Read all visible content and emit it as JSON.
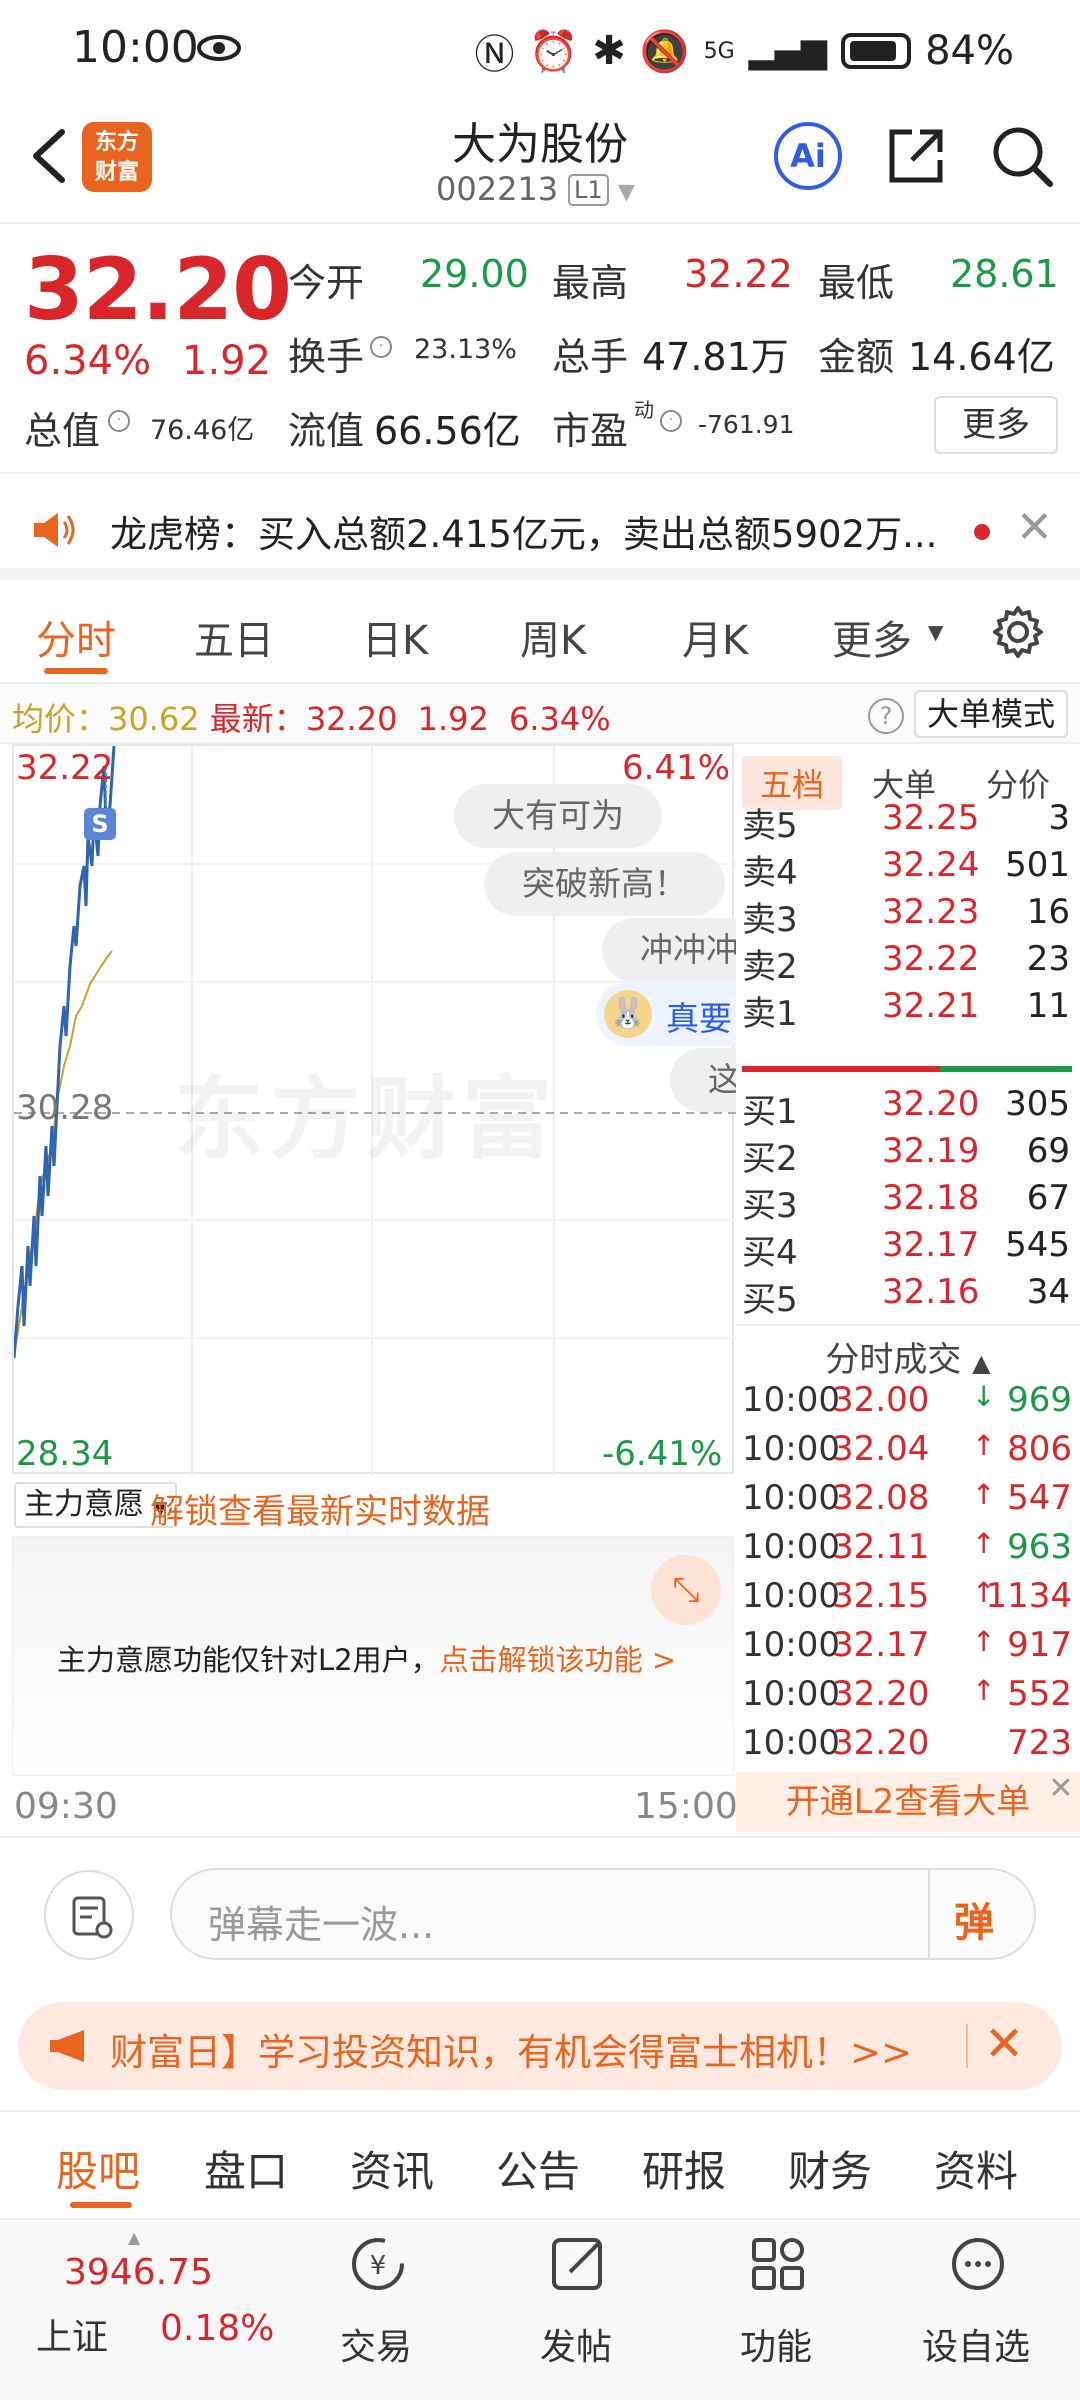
{
  "status": {
    "time": "10:00",
    "battery": "84%",
    "network": "5G"
  },
  "header": {
    "name": "大为股份",
    "code": "002213",
    "level": "L1",
    "ai_label": "Ai"
  },
  "quote": {
    "price": "32.20",
    "pct": "6.34%",
    "change": "1.92",
    "open_label": "今开",
    "open": "29.00",
    "high_label": "最高",
    "high": "32.22",
    "low_label": "最低",
    "low": "28.61",
    "turnover_label": "换手",
    "turnover": "23.13%",
    "volume_label": "总手",
    "volume": "47.81万",
    "amount_label": "金额",
    "amount": "14.64亿",
    "mktcap_label": "总值",
    "mktcap": "76.46亿",
    "float_label": "流值",
    "float": "66.56亿",
    "pe_label": "市盈",
    "pe_sup": "动",
    "pe": "-761.91",
    "more": "更多"
  },
  "banner": {
    "text": "龙虎榜：买入总额2.415亿元，卖出总额5902万..."
  },
  "chart_tabs": {
    "items": [
      "分时",
      "五日",
      "日K",
      "周K",
      "月K",
      "更多"
    ]
  },
  "avgrow": {
    "avg_label": "均价：",
    "avg": "30.62",
    "last_label": "最新：",
    "last": "32.20",
    "change": "1.92",
    "pct": "6.34%",
    "big_mode": "大单模式"
  },
  "chart": {
    "y_top": "32.22",
    "y_mid": "30.28",
    "y_bottom": "28.34",
    "pct_top": "6.41%",
    "pct_bottom": "-6.41%",
    "s_marker": "S",
    "watermark": "东方财富",
    "danmaku": [
      "大有可为",
      "突破新高！",
      "冲冲冲",
      "真要",
      "这"
    ]
  },
  "orderbook": {
    "tabs": [
      "五档",
      "大单",
      "分价"
    ],
    "asks": [
      {
        "label": "卖5",
        "price": "32.25",
        "vol": "3"
      },
      {
        "label": "卖4",
        "price": "32.24",
        "vol": "501"
      },
      {
        "label": "卖3",
        "price": "32.23",
        "vol": "16"
      },
      {
        "label": "卖2",
        "price": "32.22",
        "vol": "23"
      },
      {
        "label": "卖1",
        "price": "32.21",
        "vol": "11"
      }
    ],
    "bids": [
      {
        "label": "买1",
        "price": "32.20",
        "vol": "305"
      },
      {
        "label": "买2",
        "price": "32.19",
        "vol": "69"
      },
      {
        "label": "买3",
        "price": "32.18",
        "vol": "67"
      },
      {
        "label": "买4",
        "price": "32.17",
        "vol": "545"
      },
      {
        "label": "买5",
        "price": "32.16",
        "vol": "34"
      }
    ],
    "trades_title": "分时成交",
    "trades": [
      {
        "time": "10:00",
        "price": "32.00",
        "arrow": "↓",
        "vol": "969",
        "color": "#1a9a45"
      },
      {
        "time": "10:00",
        "price": "32.04",
        "arrow": "↑",
        "vol": "806",
        "color": "#d8262b"
      },
      {
        "time": "10:00",
        "price": "32.08",
        "arrow": "↑",
        "vol": "547",
        "color": "#d8262b"
      },
      {
        "time": "10:00",
        "price": "32.11",
        "arrow": "↑",
        "vol": "963",
        "color": "#1a9a45"
      },
      {
        "time": "10:00",
        "price": "32.15",
        "arrow": "↑",
        "vol": "1134",
        "color": "#d8262b"
      },
      {
        "time": "10:00",
        "price": "32.17",
        "arrow": "↑",
        "vol": "917",
        "color": "#d8262b"
      },
      {
        "time": "10:00",
        "price": "32.20",
        "arrow": "↑",
        "vol": "552",
        "color": "#d8262b"
      },
      {
        "time": "10:00",
        "price": "32.20",
        "arrow": "",
        "vol": "723",
        "color": "#d8262b"
      }
    ],
    "l2_label": "开通L2查看大单"
  },
  "force": {
    "dropdown": "主力意愿",
    "unlock": "解锁查看最新实时数据",
    "msg": "主力意愿功能仅针对L2用户，",
    "link": "点击解锁该功能 >"
  },
  "times": {
    "start": "09:30",
    "end": "15:00"
  },
  "comment": {
    "placeholder": "弹幕走一波...",
    "danmaku_btn": "弹"
  },
  "promo": {
    "text": "财富日】学习投资知识，有机会得富士相机！>>"
  },
  "bottom_tabs": {
    "items": [
      "股吧",
      "盘口",
      "资讯",
      "公告",
      "研报",
      "财务",
      "资料"
    ]
  },
  "nav": {
    "index_value": "3946.75",
    "index_name": "上证",
    "index_pct": "0.18%",
    "items": [
      "交易",
      "发帖",
      "功能",
      "设自选"
    ]
  },
  "colors": {
    "up": "#d8262b",
    "down": "#1a9a45",
    "accent": "#e9651f",
    "avg_line": "#c9a227",
    "price_line": "#2f64b3"
  }
}
